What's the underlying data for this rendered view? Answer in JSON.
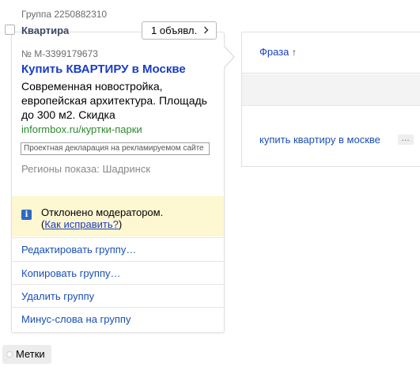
{
  "group": {
    "id_label": "Группа 2250882310",
    "title": "Квартира"
  },
  "ads_button": {
    "label": "1 объявл.",
    "icon": "chevron-right-icon"
  },
  "ad": {
    "number": "№ M-3399179673",
    "headline": "Купить КВАРТИРУ в Москве",
    "text": "Современная новостройка, европейская архитектура. Площадь до 300 м2. Скидка",
    "display_url": "informbox.ru/куртки-парки",
    "declaration": "Проектная декларация на рекламируемом сайте",
    "regions": "Регионы показа: Шадринск"
  },
  "moderation": {
    "icon": "info-icon",
    "status": "Отклонено модератором.",
    "fix_prefix": "(",
    "fix_link": "Как исправить?",
    "fix_suffix": ")"
  },
  "menu": {
    "items": [
      {
        "label": "Редактировать группу…"
      },
      {
        "label": "Копировать группу…"
      },
      {
        "label": "Удалить группу"
      },
      {
        "label": "Минус-слова на группу"
      }
    ]
  },
  "phrases": {
    "header": "Фраза",
    "sort_indicator": "↑",
    "items": [
      {
        "text": "купить квартиру в москве",
        "more": "…"
      }
    ]
  },
  "labels_button": "Метки"
}
